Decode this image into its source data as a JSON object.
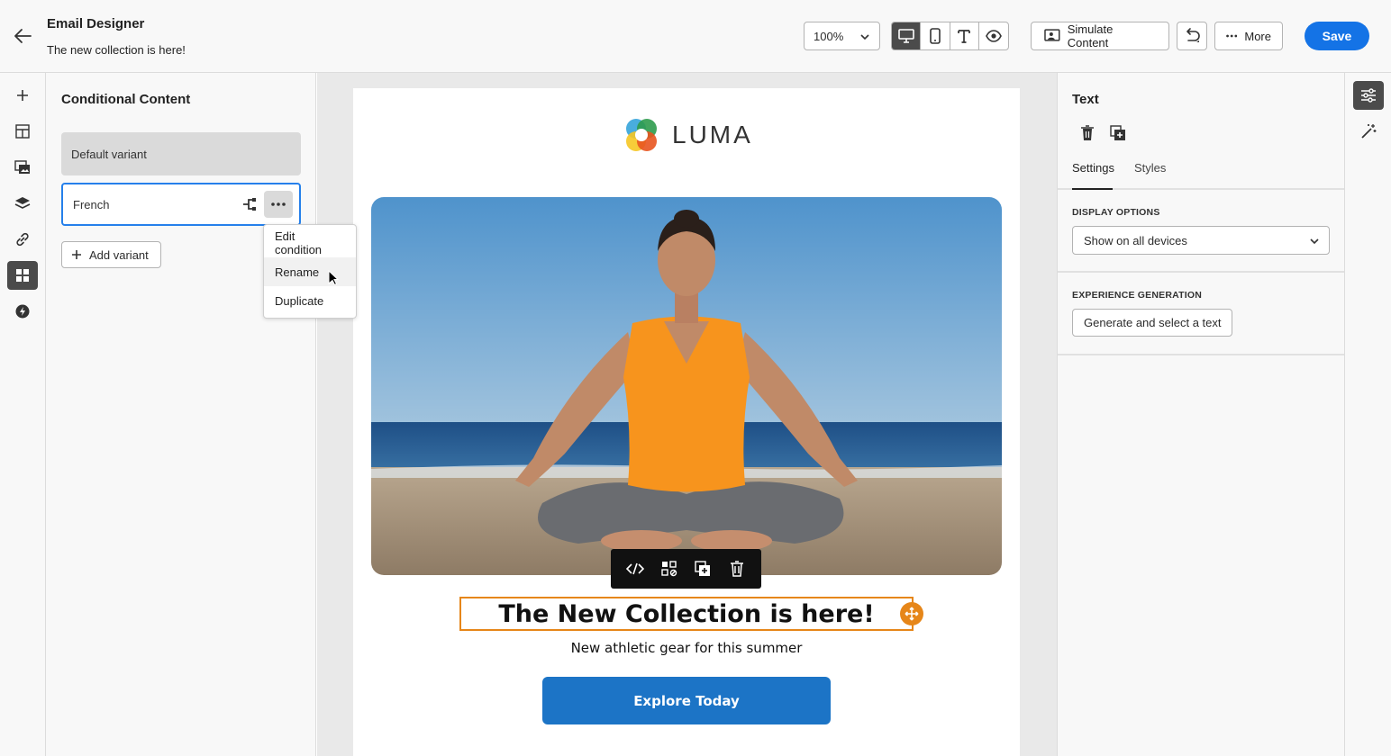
{
  "header": {
    "title": "Email Designer",
    "subtitle": "The new collection is here!",
    "zoom": "100%",
    "simulate_label": "Simulate Content",
    "more_label": "More",
    "save_label": "Save"
  },
  "view_modes": [
    "desktop-icon",
    "mobile-icon",
    "text-icon",
    "preview-icon"
  ],
  "rail": {
    "items": [
      "plus-icon",
      "structure-icon",
      "assets-icon",
      "layers-icon",
      "link-icon",
      "conditional-content-icon",
      "lightning-icon"
    ],
    "active": "conditional-content-icon"
  },
  "conditional": {
    "title": "Conditional Content",
    "default_variant": "Default variant",
    "selected_variant": "French",
    "add_variant_label": "Add variant",
    "menu": [
      "Edit condition",
      "Rename",
      "Duplicate"
    ],
    "menu_hovered": "Rename"
  },
  "email": {
    "brand": "LUMA",
    "headline": "The New Collection is here!",
    "subline": "New athletic gear for this summer",
    "cta": "Explore Today",
    "toolbar_icons": [
      "code-icon",
      "conditional-icon",
      "duplicate-icon",
      "trash-icon"
    ]
  },
  "properties": {
    "title": "Text",
    "tabs": [
      "Settings",
      "Styles"
    ],
    "active_tab": "Settings",
    "display_options_label": "DISPLAY OPTIONS",
    "display_options_value": "Show on all devices",
    "experience_label": "EXPERIENCE GENERATION",
    "generate_label": "Generate and select a text"
  },
  "colors": {
    "accent": "#1473e6",
    "selection": "#e68619",
    "cta": "#1c74c6"
  }
}
